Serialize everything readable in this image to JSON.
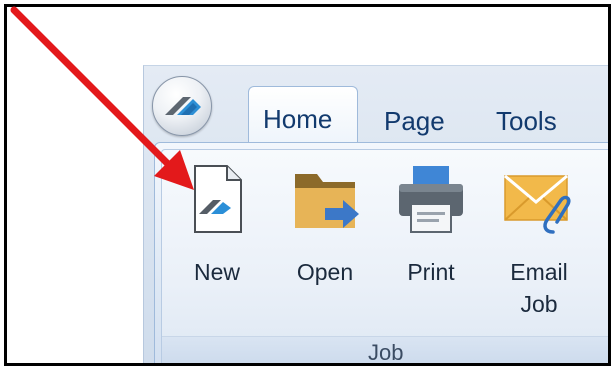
{
  "tabs": {
    "home": "Home",
    "page": "Page",
    "tools": "Tools"
  },
  "ribbon": {
    "buttons": {
      "new": "New",
      "open": "Open",
      "print": "Print",
      "email_line1": "Email",
      "email_line2": "Job"
    },
    "group_label": "Job"
  },
  "colors": {
    "arrow": "#e3191b",
    "folder": "#e7b457",
    "arrow_blue": "#3c78c8",
    "envelope": "#f2b94a"
  },
  "icons": {
    "app_button": "app-logo-icon",
    "new": "new-document-icon",
    "open": "open-folder-icon",
    "print": "printer-icon",
    "email": "email-envelope-icon",
    "annotation": "red-arrow-icon"
  }
}
